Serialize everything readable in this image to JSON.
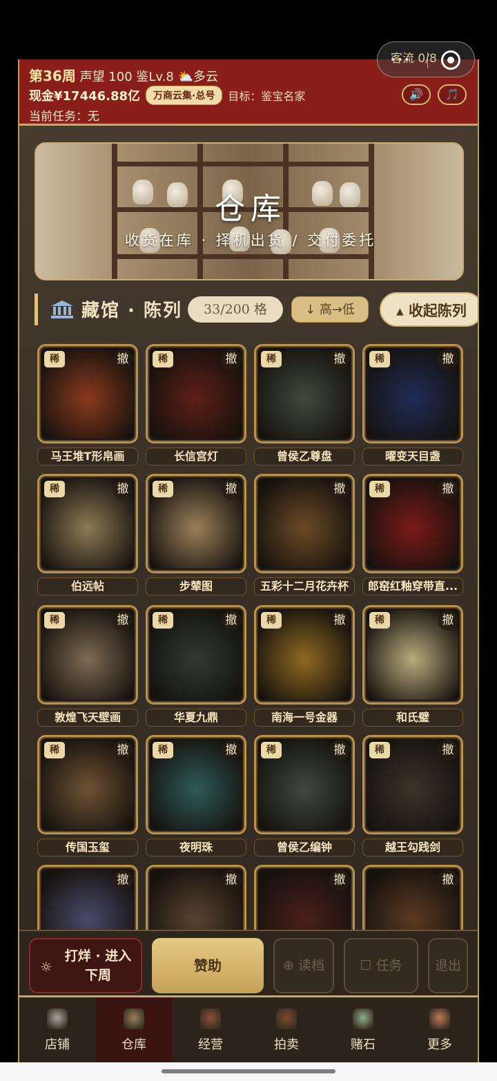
{
  "header": {
    "week": "第36周",
    "reputation": "声望 100",
    "level": "鉴Lv.8",
    "weather_icon": "partly-cloudy-icon",
    "weather": "多云",
    "cash": "现金¥17446.88亿",
    "market_badge": "万商云集·总号",
    "target": "目标：鉴宝名家",
    "task": "当前任务：无",
    "sound_icon": "🔊",
    "music_icon": "🎵",
    "visitors": "客流 0/8"
  },
  "mini_program": {
    "dots": "•••"
  },
  "banner": {
    "title": "仓库",
    "subtitle": "收货在库 · 择机出货 / 交付委托"
  },
  "section": {
    "title": "藏馆 · 陈列",
    "capacity": "33/200 格",
    "sort": "↓ 高→低",
    "collapse": "▴ 收起陈列"
  },
  "labels": {
    "rare": "稀",
    "withdraw": "撤"
  },
  "items": [
    {
      "name": "马王堆T形帛画",
      "rare": true,
      "color": "#8a3a1e"
    },
    {
      "name": "长信宫灯",
      "rare": true,
      "color": "#5e1f16"
    },
    {
      "name": "曾侯乙尊盘",
      "rare": true,
      "color": "#3f4a3a"
    },
    {
      "name": "曜变天目盏",
      "rare": true,
      "color": "#1f2c56"
    },
    {
      "name": "伯远帖",
      "rare": true,
      "color": "#8d7a55"
    },
    {
      "name": "步辇图",
      "rare": true,
      "color": "#9a805a"
    },
    {
      "name": "五彩十二月花卉杯",
      "rare": false,
      "color": "#6b4a26"
    },
    {
      "name": "郎窑红釉穿带直...",
      "rare": true,
      "color": "#7a1a18"
    },
    {
      "name": "敦煌飞天壁画",
      "rare": true,
      "color": "#7d6a52"
    },
    {
      "name": "华夏九鼎",
      "rare": true,
      "color": "#2e3a34"
    },
    {
      "name": "南海一号金器",
      "rare": true,
      "color": "#8f6a22"
    },
    {
      "name": "和氏璧",
      "rare": true,
      "color": "#b9ab7e"
    },
    {
      "name": "传国玉玺",
      "rare": true,
      "color": "#6e5234"
    },
    {
      "name": "夜明珠",
      "rare": true,
      "color": "#2f5a58"
    },
    {
      "name": "曾侯乙编钟",
      "rare": true,
      "color": "#3d4a3c"
    },
    {
      "name": "越王勾践剑",
      "rare": true,
      "color": "#3a3428"
    },
    {
      "name": "",
      "rare": false,
      "color": "#4a4a6a"
    },
    {
      "name": "",
      "rare": false,
      "color": "#5a4330"
    },
    {
      "name": "",
      "rare": false,
      "color": "#4a1f1c"
    },
    {
      "name": "",
      "rare": false,
      "color": "#5c3a22"
    }
  ],
  "actions": {
    "next_week_icon": "☼",
    "next_week_line1": "打烊 · 进入",
    "next_week_line2": "下周",
    "sponsor": "赞助",
    "load": "读档",
    "load_icon": "⊕",
    "task": "任务",
    "task_icon": "☐",
    "exit": "退出"
  },
  "tabs": [
    {
      "label": "店铺",
      "icon": "shop-icon",
      "color": "#a7a6a0"
    },
    {
      "label": "仓库",
      "icon": "warehouse-icon",
      "color": "#9a7f5b"
    },
    {
      "label": "经营",
      "icon": "abacus-icon",
      "color": "#8a4f3c"
    },
    {
      "label": "拍卖",
      "icon": "gavel-icon",
      "color": "#7a4a2b"
    },
    {
      "label": "赌石",
      "icon": "jade-stone-icon",
      "color": "#8fae8c"
    },
    {
      "label": "更多",
      "icon": "more-icon",
      "color": "#c07a5a"
    }
  ],
  "active_tab": "仓库"
}
